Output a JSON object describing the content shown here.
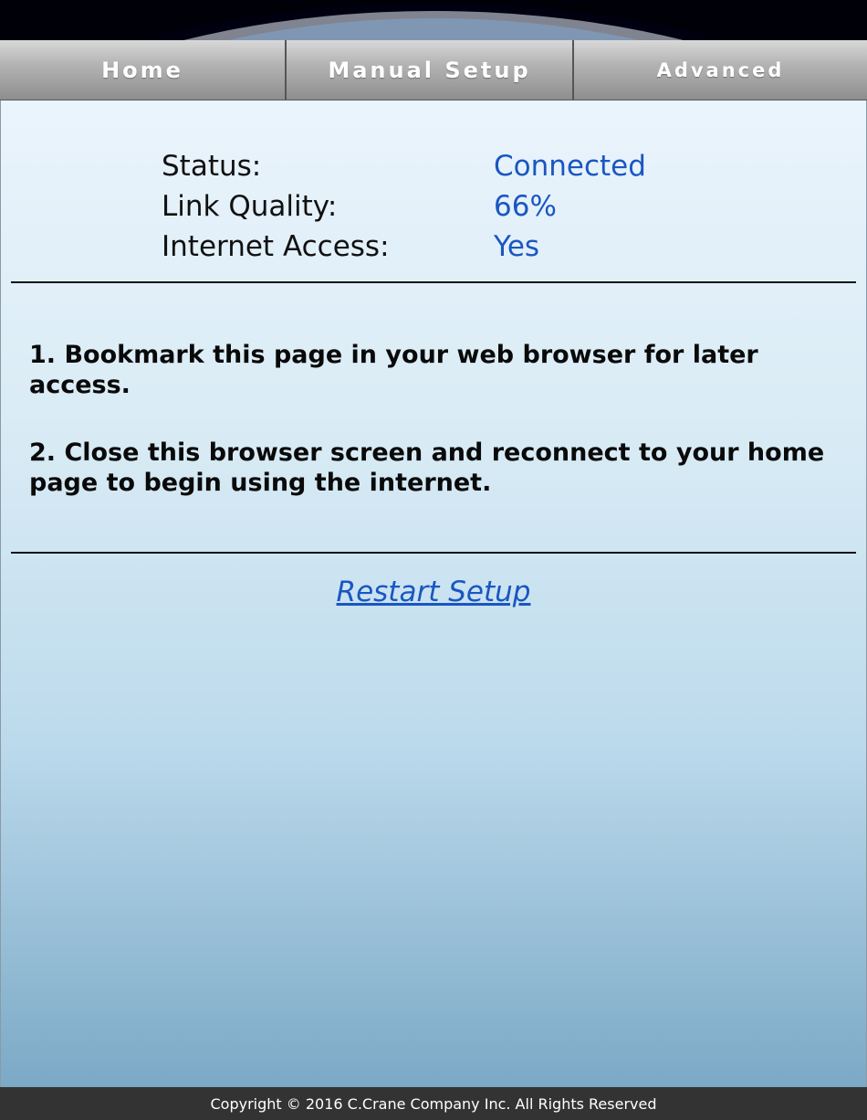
{
  "nav": {
    "tabs": [
      {
        "label": "Home"
      },
      {
        "label": "Manual Setup"
      },
      {
        "label": "Advanced"
      }
    ]
  },
  "status": {
    "rows": [
      {
        "label": "Status:",
        "value": "Connected"
      },
      {
        "label": "Link Quality:",
        "value": "66%"
      },
      {
        "label": "Internet Access:",
        "value": "Yes"
      }
    ]
  },
  "instructions": [
    "1. Bookmark this page in your web browser for later access.",
    "2. Close this browser screen and reconnect to your home page to begin using the internet."
  ],
  "restart_link": "Restart Setup",
  "footer": {
    "copyright": "Copyright © 2016 C.Crane Company Inc. All Rights Reserved"
  },
  "colors": {
    "value_text": "#1a56c2",
    "footer_bg": "#333333"
  }
}
